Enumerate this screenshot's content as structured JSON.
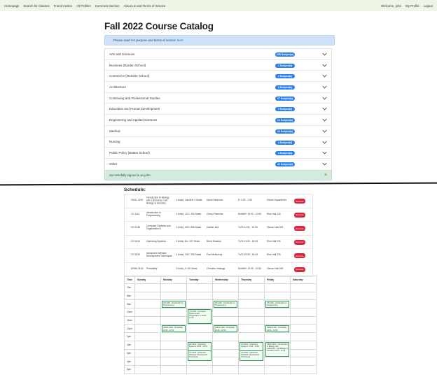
{
  "nav": {
    "left": [
      "Homepage",
      "Search for Classes",
      "Friend Invites",
      "All Profiles",
      "Comment Section",
      "About us and Terms of Service"
    ],
    "right": [
      "Welcome, john",
      "My Profile",
      "Logout"
    ]
  },
  "page_title": "Fall 2022 Course Catalog",
  "info_banner": {
    "text": "Please read our purpose and terms of service",
    "link": "here"
  },
  "accordion": [
    {
      "label": "Arts and Sciences",
      "badge": "108 Subject(s)"
    },
    {
      "label": "Business (Darden School)",
      "badge": "1 Subject(s)"
    },
    {
      "label": "Commerce (McIntire School)",
      "badge": "2 Subject(s)"
    },
    {
      "label": "Architecture",
      "badge": "8 Subject(s)"
    },
    {
      "label": "Continuing and Professional Studies",
      "badge": "17 Subject(s)"
    },
    {
      "label": "Education and Human Development",
      "badge": "9 Subject(s)"
    },
    {
      "label": "Engineering and Applied Sciences",
      "badge": "14 Subject(s)"
    },
    {
      "label": "Medical",
      "badge": "10 Subject(s)"
    },
    {
      "label": "Nursing",
      "badge": "2 Subject(s)"
    },
    {
      "label": "Public Policy (Batten School)",
      "badge": "4 Subject(s)"
    },
    {
      "label": "Other",
      "badge": "42 Subject(s)"
    }
  ],
  "success_alert": {
    "text": "Successfully signed in as john.",
    "close": "×"
  },
  "schedule": {
    "title": "Schedule:",
    "drop_label": "Remove",
    "courses": [
      {
        "code": "CBOL 3190",
        "name": "Introduction to Biology with Laboratory: Cell Biology & Genetics",
        "credits": "4 Units | Lab-MW 3 Seats",
        "prof": "David Hirshman",
        "time": "Fr 1:00 - 1:50",
        "room": "Gilmer Department"
      },
      {
        "code": "CS 1110",
        "name": "Introduction to Programming",
        "credits": "3 Units | 123 / 150 Seats",
        "prof": "Cheryl Pamcher",
        "time": "MoWeFr 10:00 - 10:50",
        "room": "Rice Hall 130"
      },
      {
        "code": "CS 2130",
        "name": "Computer Systems and Organization 1",
        "credits": "4 Units | 223 / 250 Seats",
        "prof": "Hadder Kell",
        "time": "TuTh 11:00 - 12:15",
        "room": "Olsson Hall 009"
      },
      {
        "code": "CS 3414",
        "name": "Operating Systems",
        "credits": "3 Units | 84 / 107 Seats",
        "prof": "Brent Shadow",
        "time": "TuTh 14:00 - 15:15",
        "room": "Rice Hall 130"
      },
      {
        "code": "CS 3240",
        "name": "Advanced Software Development Techniques",
        "credits": "3 Units | 106 / 150 Seats",
        "prof": "Paul McBurney",
        "time": "TuTh 15:30 - 16:45",
        "room": "Rice Hall 130"
      },
      {
        "code": "APMA 3100",
        "name": "Probability",
        "credits": "3 Units | 0 / 60 Seats",
        "prof": "Christina Yedlings",
        "time": "MoWeFr 12:00 - 12:50",
        "room": "Olsson Hall 009"
      }
    ]
  },
  "week": {
    "headers": [
      "Time",
      "Sunday",
      "Monday",
      "Tuesday",
      "Wednesday",
      "Thursday",
      "Friday",
      "Saturday"
    ],
    "times": [
      "7am",
      "8am",
      "9am",
      "10am",
      "11am",
      "12pm",
      "1pm",
      "2pm",
      "3pm",
      "4pm",
      "5pm"
    ],
    "events": [
      {
        "day": 2,
        "slot": 2,
        "text": "CS 1110 - Introduction to Programming",
        "size": "short"
      },
      {
        "day": 3,
        "slot": 3,
        "text": "CS 2130 - Computer Systems and Organization 1  10:00 - 11:15",
        "size": "tall"
      },
      {
        "day": 4,
        "slot": 2,
        "text": "CS 1110 - Introduction to Programming",
        "size": "short"
      },
      {
        "day": 6,
        "slot": 2,
        "text": "CS 1110 - Introduction to Programming",
        "size": "short"
      },
      {
        "day": 2,
        "slot": 5,
        "text": "APMA 3100 - Probability 12:00 - 12:50",
        "size": "short"
      },
      {
        "day": 4,
        "slot": 5,
        "text": "APMA 3100 - Probability 12:00 - 12:50",
        "size": "short"
      },
      {
        "day": 6,
        "slot": 5,
        "text": "APMA 3100 - Probability 12:00 - 12:50",
        "size": "short"
      },
      {
        "day": 3,
        "slot": 7,
        "text": "CS 3414 - Operating Systems  14:00 - 15:15",
        "size": "med"
      },
      {
        "day": 5,
        "slot": 7,
        "text": "CS 3414 - Operating Systems  14:00 - 15:15",
        "size": "med"
      },
      {
        "day": 3,
        "slot": 8,
        "text": "CS 3240 - Advanced Software Development Techniques",
        "size": "med"
      },
      {
        "day": 5,
        "slot": 8,
        "text": "CS 3240 - Advanced Software Development Techniques",
        "size": "med"
      },
      {
        "day": 6,
        "slot": 7,
        "text": "CBOL 3190 - Introduction to Biology with Laboratory: Cell Biology & Genetics  13:00 - 17:00",
        "size": "tall"
      }
    ]
  },
  "colors": {
    "accent": "#2a7df2",
    "danger": "#d7263d",
    "success_bg": "#d4ebdc",
    "info_bg": "#cfe2f7",
    "event_border": "#2e9d52"
  }
}
